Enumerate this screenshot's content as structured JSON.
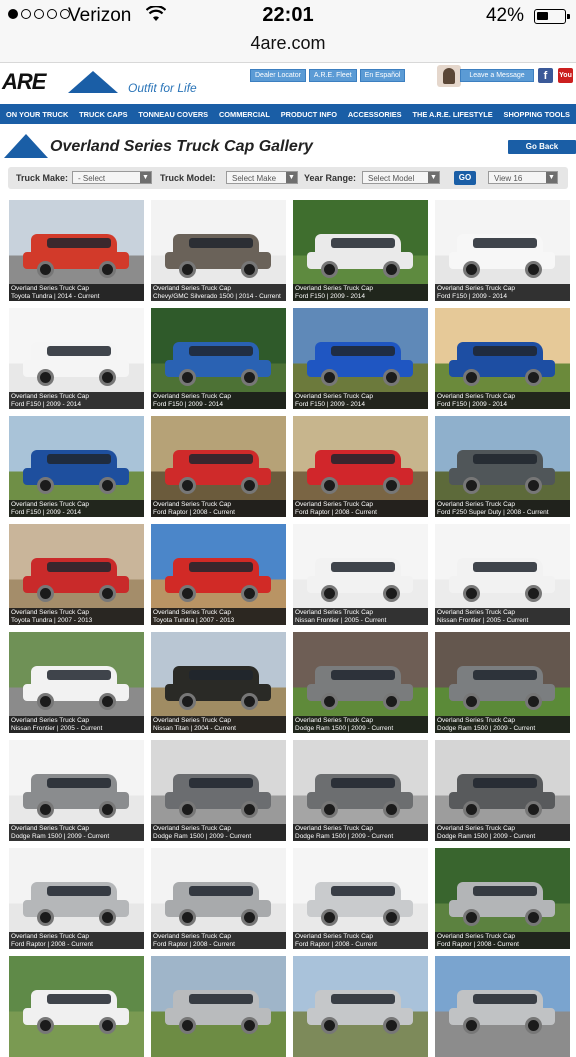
{
  "status": {
    "carrier": "Verizon",
    "time": "22:01",
    "battery": "42%"
  },
  "url": "4are.com",
  "header": {
    "logo_text": "ARE",
    "tagline": "Outfit for Life",
    "links": [
      "Dealer Locator",
      "A.R.E. Fleet",
      "En Español"
    ],
    "leave_message": "Leave a Message",
    "facebook": "f",
    "youtube": "You"
  },
  "nav": [
    "ON YOUR TRUCK",
    "TRUCK CAPS",
    "TONNEAU COVERS",
    "COMMERCIAL",
    "PRODUCT INFO",
    "ACCESSORIES",
    "THE A.R.E. LIFESTYLE",
    "SHOPPING TOOLS"
  ],
  "gallery": {
    "title": "Overland Series Truck Cap Gallery",
    "go_back": "Go Back"
  },
  "filters": {
    "make_label": "Truck Make:",
    "make_value": "- Select",
    "model_label": "Truck Model:",
    "model_value": "Select Make",
    "year_label": "Year Range:",
    "year_value": "Select Model",
    "go": "GO",
    "view_value": "View 16"
  },
  "tiles": [
    {
      "t": "Overland Series Truck Cap",
      "s": "Toyota Tundra | 2014 - Current",
      "sky": "#c8d2dc",
      "ground": "#8c8c8c",
      "truck": "#d23a2a"
    },
    {
      "t": "Overland Series Truck Cap",
      "s": "Chevy/GMC Silverado 1500 | 2014 - Current",
      "sky": "#f3f3f3",
      "ground": "#e9e9e9",
      "truck": "#6a6259"
    },
    {
      "t": "Overland Series Truck Cap",
      "s": "Ford F150 | 2009 - 2014",
      "sky": "#3f6e2e",
      "ground": "#5e8a3f",
      "truck": "#eaeaea"
    },
    {
      "t": "Overland Series Truck Cap",
      "s": "Ford F150 | 2009 - 2014",
      "sky": "#f4f4f4",
      "ground": "#e6e6e6",
      "truck": "#f7f7f7"
    },
    {
      "t": "Overland Series Truck Cap",
      "s": "Ford F150 | 2009 - 2014",
      "sky": "#f6f6f6",
      "ground": "#e8e8e8",
      "truck": "#f5f5f5"
    },
    {
      "t": "Overland Series Truck Cap",
      "s": "Ford F150 | 2009 - 2014",
      "sky": "#2f5a2a",
      "ground": "#4d7235",
      "truck": "#2a62b3"
    },
    {
      "t": "Overland Series Truck Cap",
      "s": "Ford F150 | 2009 - 2014",
      "sky": "#5f89b8",
      "ground": "#6c7a3c",
      "truck": "#1f56c2"
    },
    {
      "t": "Overland Series Truck Cap",
      "s": "Ford F150 | 2009 - 2014",
      "sky": "#e6c998",
      "ground": "#6b8a3b",
      "truck": "#1d4ea3"
    },
    {
      "t": "Overland Series Truck Cap",
      "s": "Ford F150 | 2009 - 2014",
      "sky": "#a9c3d8",
      "ground": "#6f8f46",
      "truck": "#1e4f9e"
    },
    {
      "t": "Overland Series Truck Cap",
      "s": "Ford Raptor | 2008 - Current",
      "sky": "#b6a277",
      "ground": "#6b5b3c",
      "truck": "#cf2a2a"
    },
    {
      "t": "Overland Series Truck Cap",
      "s": "Ford Raptor | 2008 - Current",
      "sky": "#c7b58d",
      "ground": "#7a6544",
      "truck": "#d1262b"
    },
    {
      "t": "Overland Series Truck Cap",
      "s": "Ford F250 Super Duty | 2008 - Current",
      "sky": "#8fb0cc",
      "ground": "#5d6a3a",
      "truck": "#505659"
    },
    {
      "t": "Overland Series Truck Cap",
      "s": "Toyota Tundra | 2007 - 2013",
      "sky": "#c9b59a",
      "ground": "#a48d6a",
      "truck": "#c92a2a"
    },
    {
      "t": "Overland Series Truck Cap",
      "s": "Toyota Tundra | 2007 - 2013",
      "sky": "#4b86c9",
      "ground": "#b99464",
      "truck": "#d12a26"
    },
    {
      "t": "Overland Series Truck Cap",
      "s": "Nissan Frontier | 2005 - Current",
      "sky": "#f5f5f5",
      "ground": "#ececec",
      "truck": "#f2f2f2"
    },
    {
      "t": "Overland Series Truck Cap",
      "s": "Nissan Frontier | 2005 - Current",
      "sky": "#f5f5f5",
      "ground": "#ececec",
      "truck": "#f2f2f2"
    },
    {
      "t": "Overland Series Truck Cap",
      "s": "Nissan Frontier | 2005 - Current",
      "sky": "#6f9156",
      "ground": "#8b8b8b",
      "truck": "#f2f2f2"
    },
    {
      "t": "Overland Series Truck Cap",
      "s": "Nissan Titan | 2004 - Current",
      "sky": "#b9c6d3",
      "ground": "#a08c63",
      "truck": "#2a2a26"
    },
    {
      "t": "Overland Series Truck Cap",
      "s": "Dodge Ram 1500 | 2009 - Current",
      "sky": "#6e5e55",
      "ground": "#5f8a3a",
      "truck": "#7a7c7d"
    },
    {
      "t": "Overland Series Truck Cap",
      "s": "Dodge Ram 1500 | 2009 - Current",
      "sky": "#64574e",
      "ground": "#5b8a38",
      "truck": "#7b7e80"
    },
    {
      "t": "Overland Series Truck Cap",
      "s": "Dodge Ram 1500 | 2009 - Current",
      "sky": "#f4f4f4",
      "ground": "#e8e8e8",
      "truck": "#8a8c8e"
    },
    {
      "t": "Overland Series Truck Cap",
      "s": "Dodge Ram 1500 | 2009 - Current",
      "sky": "#d8d8d8",
      "ground": "#9a9a9a",
      "truck": "#6b6d70"
    },
    {
      "t": "Overland Series Truck Cap",
      "s": "Dodge Ram 1500 | 2009 - Current",
      "sky": "#d9d9d9",
      "ground": "#a5a5a5",
      "truck": "#6c6e70"
    },
    {
      "t": "Overland Series Truck Cap",
      "s": "Dodge Ram 1500 | 2009 - Current",
      "sky": "#d5d5d5",
      "ground": "#9d9d9d",
      "truck": "#585a5c"
    },
    {
      "t": "Overland Series Truck Cap",
      "s": "Ford Raptor | 2008 - Current",
      "sky": "#f3f3f3",
      "ground": "#e7e7e7",
      "truck": "#b5b7b9"
    },
    {
      "t": "Overland Series Truck Cap",
      "s": "Ford Raptor | 2008 - Current",
      "sky": "#f3f3f3",
      "ground": "#e7e7e7",
      "truck": "#a8aaac"
    },
    {
      "t": "Overland Series Truck Cap",
      "s": "Ford Raptor | 2008 - Current",
      "sky": "#f5f5f5",
      "ground": "#e9e9e9",
      "truck": "#c9cbcd"
    },
    {
      "t": "Overland Series Truck Cap",
      "s": "Ford Raptor | 2008 - Current",
      "sky": "#39652e",
      "ground": "#5c8240",
      "truck": "#b3b5b7"
    },
    {
      "t": "",
      "s": "",
      "sky": "#5f8a48",
      "ground": "#7a9a52",
      "truck": "#f0f0f0"
    },
    {
      "t": "",
      "s": "",
      "sky": "#9fb5c9",
      "ground": "#6d8c44",
      "truck": "#b9bbbd"
    },
    {
      "t": "",
      "s": "",
      "sky": "#a9c2da",
      "ground": "#7d8a5a",
      "truck": "#c5c7c9"
    },
    {
      "t": "",
      "s": "",
      "sky": "#7aa4cf",
      "ground": "#8c8c8c",
      "truck": "#c0c2c4"
    }
  ]
}
